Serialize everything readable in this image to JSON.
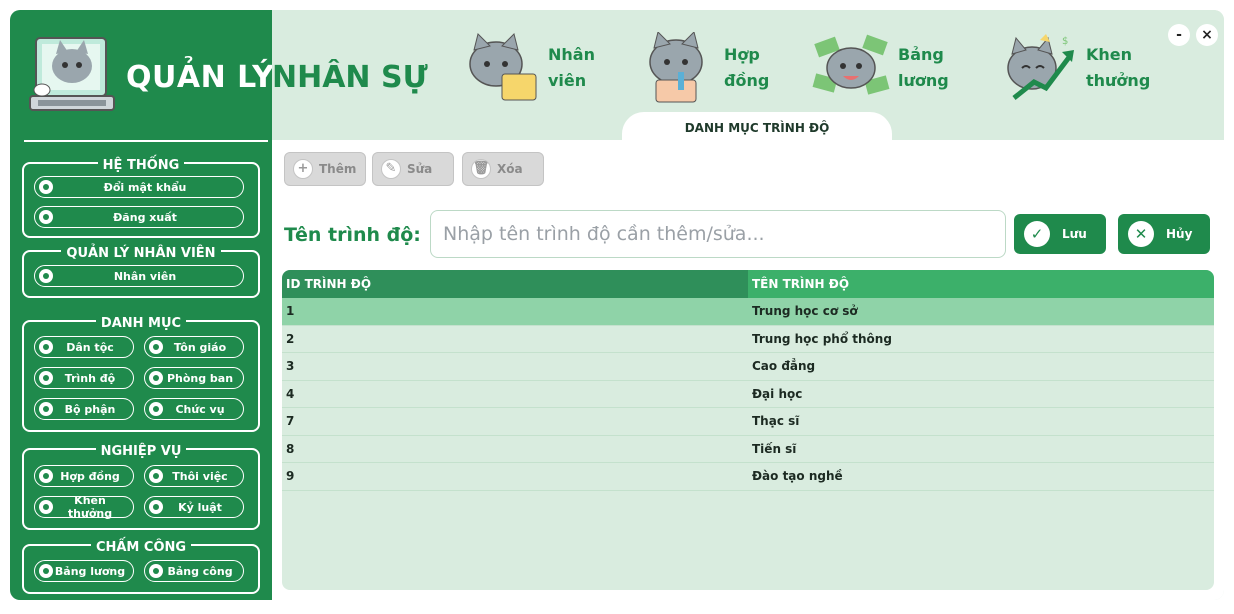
{
  "app": {
    "title_part1": "QUẢN LÝ",
    "title_part2": "NHÂN SỰ"
  },
  "sidebar": {
    "groups": {
      "he_thong": {
        "title": "HỆ THỐNG",
        "items": [
          "Đổi mật khẩu",
          "Đăng xuất"
        ]
      },
      "quan_ly_nhan_vien": {
        "title": "QUẢN LÝ NHÂN VIÊN",
        "items": [
          "Nhân viên"
        ]
      },
      "danh_muc": {
        "title": "DANH MỤC",
        "items": [
          "Dân tộc",
          "Tôn giáo",
          "Trình độ",
          "Phòng ban",
          "Bộ phận",
          "Chức vụ"
        ]
      },
      "nghiep_vu": {
        "title": "NGHIỆP VỤ",
        "items": [
          "Hợp đồng",
          "Thôi việc",
          "Khen thưởng",
          "Kỷ luật"
        ]
      },
      "cham_cong": {
        "title": "CHẤM CÔNG",
        "items": [
          "Bảng lương",
          "Bảng công"
        ]
      }
    }
  },
  "header": {
    "nav": [
      {
        "line1": "Nhân",
        "line2": "viên",
        "icon": "cat-laptop-icon"
      },
      {
        "line1": "Hợp",
        "line2": "đồng",
        "icon": "cat-contract-icon"
      },
      {
        "line1": "Bảng",
        "line2": "lương",
        "icon": "cat-money-icon"
      },
      {
        "line1": "Khen",
        "line2": "thưởng",
        "icon": "cat-reward-icon"
      }
    ],
    "current_tab": "DANH MỤC TRÌNH ĐỘ",
    "minimize": "-",
    "close": "×"
  },
  "toolbar": {
    "add": "Thêm",
    "edit": "Sửa",
    "delete": "Xóa"
  },
  "form": {
    "label": "Tên trình độ:",
    "placeholder": "Nhập tên trình độ cần thêm/sửa...",
    "save": "Lưu",
    "cancel": "Hủy"
  },
  "table": {
    "columns": [
      "ID TRÌNH ĐỘ",
      "TÊN TRÌNH ĐỘ"
    ],
    "rows": [
      {
        "id": "1",
        "name": "Trung học cơ sở",
        "selected": true
      },
      {
        "id": "2",
        "name": "Trung học phổ thông"
      },
      {
        "id": "3",
        "name": "Cao đẳng"
      },
      {
        "id": "4",
        "name": "Đại học"
      },
      {
        "id": "7",
        "name": "Thạc sĩ"
      },
      {
        "id": "8",
        "name": "Tiến sĩ"
      },
      {
        "id": "9",
        "name": "Đào tạo nghề"
      }
    ]
  },
  "colors": {
    "brand_green": "#1f8a4c",
    "light_green_bg": "#d9ecdf",
    "selected_row": "#8fd3a8"
  }
}
